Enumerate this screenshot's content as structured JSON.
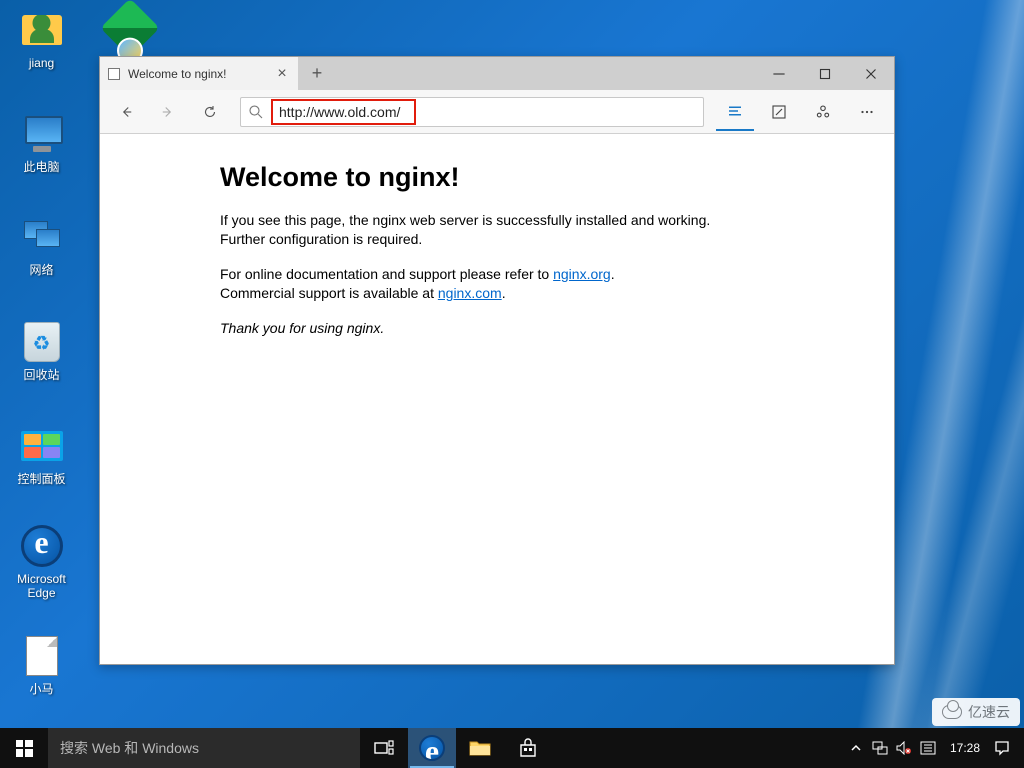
{
  "desktop": {
    "icons": [
      {
        "label": "jiang"
      },
      {
        "label": "此电脑"
      },
      {
        "label": "网络"
      },
      {
        "label": "回收站"
      },
      {
        "label": "控制面板"
      },
      {
        "label": "Microsoft Edge"
      },
      {
        "label": "小马"
      }
    ]
  },
  "browser": {
    "tab_title": "Welcome to nginx!",
    "url": "http://www.old.com/",
    "page": {
      "heading": "Welcome to nginx!",
      "p1": "If you see this page, the nginx web server is successfully installed and working. Further configuration is required.",
      "p2_a": "For online documentation and support please refer to ",
      "link1": "nginx.org",
      "p2_b": ".",
      "p3_a": "Commercial support is available at ",
      "link2": "nginx.com",
      "p3_b": ".",
      "thanks": "Thank you for using nginx."
    }
  },
  "taskbar": {
    "search_placeholder": "搜索 Web 和 Windows",
    "clock": "17:28"
  },
  "watermark": "亿速云"
}
